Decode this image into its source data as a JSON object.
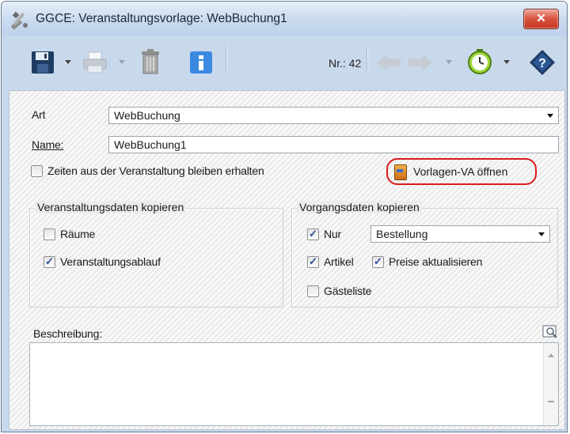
{
  "window": {
    "title": "GGCE: Veranstaltungsvorlage: WebBuchung1",
    "close_label": "✕"
  },
  "toolbar": {
    "nr_label": "Nr.: 42",
    "icons": [
      "save-icon",
      "print-icon",
      "trash-icon",
      "info-icon",
      "arrow-left-icon",
      "arrow-right-icon",
      "clock-icon",
      "help-icon"
    ]
  },
  "form": {
    "art_label": "Art",
    "art_value": "WebBuchung",
    "name_label": "Name:",
    "name_value": "WebBuchung1",
    "keep_times_label": "Zeiten aus der Veranstaltung bleiben erhalten",
    "keep_times_checked": false,
    "open_template_label": "Vorlagen-VA öffnen"
  },
  "group_event": {
    "title": "Veranstaltungsdaten kopieren",
    "rooms_label": "Räume",
    "rooms_checked": false,
    "schedule_label": "Veranstaltungsablauf",
    "schedule_checked": true
  },
  "group_process": {
    "title": "Vorgangsdaten kopieren",
    "only_label": "Nur",
    "only_checked": true,
    "only_select_value": "Bestellung",
    "articles_label": "Artikel",
    "articles_checked": true,
    "update_prices_label": "Preise aktualisieren",
    "update_prices_checked": true,
    "guestlist_label": "Gästeliste",
    "guestlist_checked": false
  },
  "description": {
    "label": "Beschreibung:",
    "value": ""
  },
  "colors": {
    "frame": "#c9d9ec",
    "highlight_ring": "#d91c1c",
    "close_button": "#d8533f"
  }
}
